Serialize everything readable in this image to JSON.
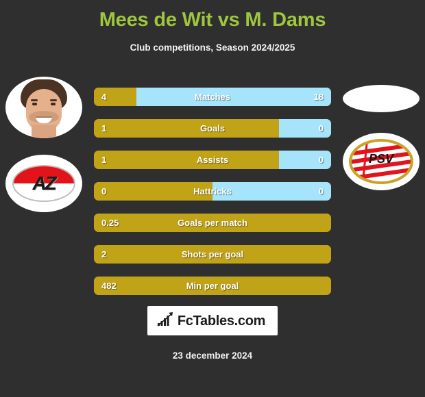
{
  "header": {
    "title": "Mees de Wit vs M. Dams",
    "subtitle": "Club competitions, Season 2024/2025",
    "title_color": "#9fc63f"
  },
  "colors": {
    "background": "#2f2f2f",
    "left_player": "#c1a317",
    "right_player": "#a6e4fb",
    "title": "#9fc63f",
    "text": "#ffffff"
  },
  "left_player": {
    "photo_alt": "player-photo",
    "club_badge": "az-alkmaar-crest",
    "club_name": "AZ"
  },
  "right_player": {
    "photo_alt": "player-photo-placeholder",
    "club_badge": "psv-eindhoven-crest",
    "club_name": "PSV"
  },
  "chart_data": {
    "type": "bar",
    "title": "Mees de Wit vs M. Dams",
    "subtitle": "Club competitions, Season 2024/2025",
    "orientation": "horizontal-diverging",
    "series": [
      {
        "name": "Mees de Wit",
        "color": "#c1a317"
      },
      {
        "name": "M. Dams",
        "color": "#a6e4fb"
      }
    ],
    "rows": [
      {
        "label": "Matches",
        "left": "4",
        "right": "18",
        "left_pct": 18,
        "right_pct": 82,
        "two_sided": true
      },
      {
        "label": "Goals",
        "left": "1",
        "right": "0",
        "left_pct": 78,
        "right_pct": 22,
        "two_sided": true
      },
      {
        "label": "Assists",
        "left": "1",
        "right": "0",
        "left_pct": 78,
        "right_pct": 22,
        "two_sided": true
      },
      {
        "label": "Hattricks",
        "left": "0",
        "right": "0",
        "left_pct": 50,
        "right_pct": 50,
        "two_sided": true
      },
      {
        "label": "Goals per match",
        "left": "0.25",
        "right": "",
        "left_pct": 100,
        "right_pct": 0,
        "two_sided": false
      },
      {
        "label": "Shots per goal",
        "left": "2",
        "right": "",
        "left_pct": 100,
        "right_pct": 0,
        "two_sided": false
      },
      {
        "label": "Min per goal",
        "left": "482",
        "right": "",
        "left_pct": 100,
        "right_pct": 0,
        "two_sided": false
      }
    ]
  },
  "footer": {
    "brand": "FcTables.com",
    "brand_icon": "bar-chart-icon",
    "date": "23 december 2024"
  }
}
